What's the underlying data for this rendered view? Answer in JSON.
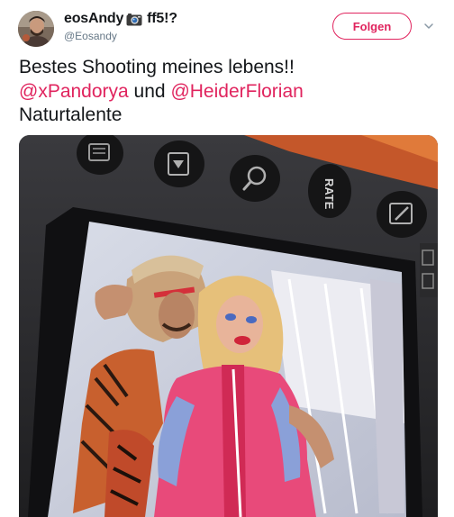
{
  "author": {
    "display_name": "eosAndy",
    "display_name_suffix": "ff5!?",
    "emoji_icon": "camera-emoji",
    "handle": "@Eosandy"
  },
  "actions": {
    "follow_label": "Folgen",
    "more_icon": "chevron-down-icon"
  },
  "tweet": {
    "line1": "Bestes Shooting meines lebens!!",
    "mention1": "@xPandorya",
    "connector": " und ",
    "mention2": "@HeiderFlorian",
    "line3": "Naturtalente"
  },
  "media": {
    "camera_button_label": "RATE"
  },
  "colors": {
    "accent": "#e0245e",
    "secondary_text": "#657786"
  }
}
